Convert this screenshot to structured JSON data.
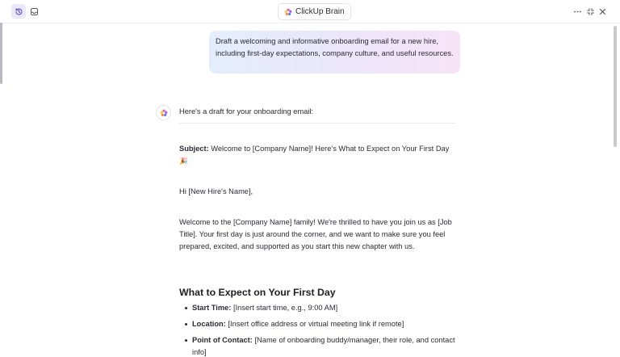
{
  "header": {
    "brand_label": "ClickUp Brain"
  },
  "prompt": {
    "text": "Draft a welcoming and informative onboarding email for a new hire, including first-day expectations, company culture, and useful resources."
  },
  "reply": {
    "intro": "Here's a draft for your onboarding email:",
    "subject_label": "Subject:",
    "subject_text": " Welcome to [Company Name]! Here's What to Expect on Your First Day ",
    "subject_emoji": "🎉",
    "greeting": "Hi [New Hire's Name],",
    "welcome_paragraph": "Welcome to the [Company Name] family! We're thrilled to have you join us as [Job Title]. Your first day is just around the corner, and we want to make sure you feel prepared, excited, and supported as you start this new chapter with us.",
    "section_heading": "What to Expect on Your First Day",
    "bullets": [
      {
        "label": "Start Time:",
        "text": " [Insert start time, e.g., 9:00 AM]"
      },
      {
        "label": "Location:",
        "text": " [Insert office address or virtual meeting link if remote]"
      },
      {
        "label": "Point of Contact:",
        "text": " [Name of onboarding buddy/manager, their role, and contact info]"
      }
    ]
  },
  "icons": {
    "history": "history-icon",
    "inbox": "inbox-icon",
    "brand": "clickup-brain-logo-icon",
    "more": "more-horizontal-icon",
    "minimize": "minimize-icon",
    "close": "close-icon"
  },
  "colors": {
    "accent": "#7b68ee",
    "active_button_bg": "#ebe8fb",
    "bubble_gradient_start": "#e4edfb",
    "bubble_gradient_end": "#f7e3f6"
  }
}
